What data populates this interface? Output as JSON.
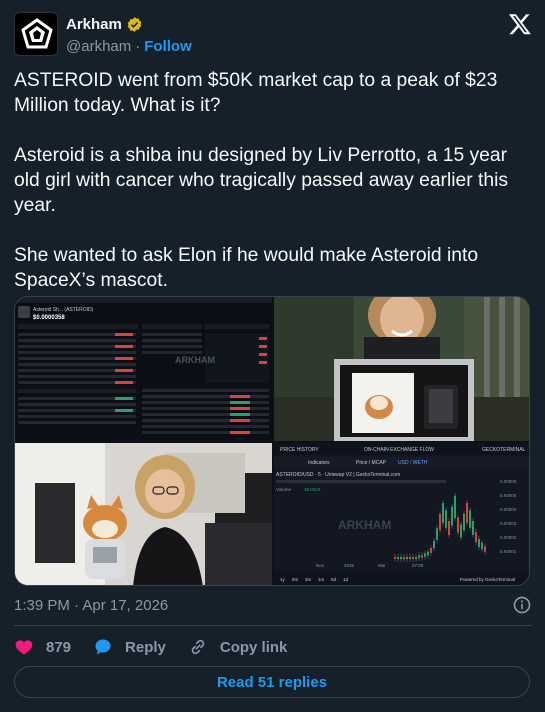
{
  "author": {
    "display_name": "Arkham",
    "handle": "@arkham",
    "separator": "·",
    "follow_label": "Follow"
  },
  "tweet": {
    "paragraphs": [
      "ASTEROID went from $50K market cap to a peak of $23 Million today. What is it?",
      "Asteroid is a shiba inu designed by Liv Perrotto, a 15 year old girl with cancer who tragically passed away earlier this year.",
      "She wanted to ask Elon if he would make Asteroid into SpaceX’s mascot."
    ]
  },
  "media": {
    "screenshot_1": {
      "token_name": "Asteroid Sh... (ASTEROID)",
      "price": "$0.0000358",
      "watermark": "ARKHAM"
    },
    "screenshot_2": {
      "tabs": [
        "PRICE HISTORY",
        "ON-CHAIN EXCHANGE FLOW",
        "GECKOTERMINAL"
      ],
      "toolbar": [
        "Indicators",
        "Price / MCAP",
        "USD / WETH"
      ],
      "pair_title": "ASTEROID/USD · 5 · Uniswap V2 | GeckoTerminal.com",
      "volume_label": "Volume",
      "volume_value": "38.0024",
      "watermark": "ARKHAM",
      "time_ranges": [
        "1y",
        "6m",
        "3m",
        "1m",
        "5d",
        "1d"
      ],
      "powered_by": "Powered by GeckoTerminal",
      "x_ticks": [
        "Nov",
        "2026",
        "Mar",
        "07:00"
      ],
      "y_ticks": [
        "0.00006",
        "0.00005",
        "0.00004",
        "0.00003",
        "0.00002",
        "0.00001"
      ]
    }
  },
  "meta": {
    "timestamp": "1:39 PM · Apr 17, 2026"
  },
  "actions": {
    "like_count": "879",
    "reply_label": "Reply",
    "copy_link_label": "Copy link"
  },
  "read_replies_label": "Read 51 replies",
  "colors": {
    "background": "#15202b",
    "text": "#f7f9f9",
    "secondary": "#8b98a5",
    "accent": "#1d9bf0",
    "like": "#f91880",
    "verified_gold": "#e2b719",
    "border": "#38444d"
  }
}
